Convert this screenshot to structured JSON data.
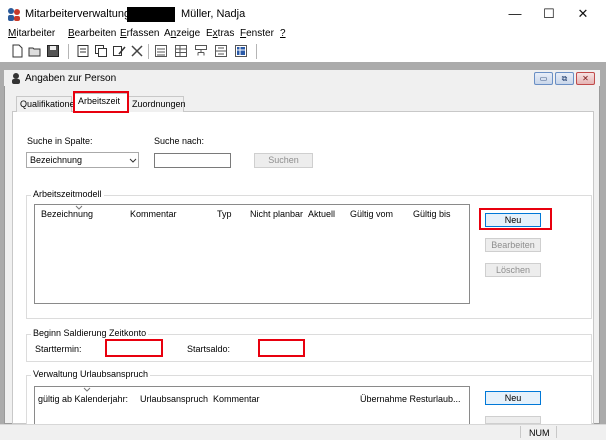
{
  "window": {
    "title_prefix": "Mitarbeiterverwaltung - ",
    "title_suffix": "Müller, Nadja",
    "minimize": "—",
    "maximize": "☐",
    "close": "✕"
  },
  "menu": [
    {
      "label": "Mitarbeiter",
      "accel": "M"
    },
    {
      "label": "Bearbeiten",
      "accel": "B"
    },
    {
      "label": "Erfassen",
      "accel": "E"
    },
    {
      "label": "Anzeige",
      "accel": "n"
    },
    {
      "label": "Extras",
      "accel": "x"
    },
    {
      "label": "Fenster",
      "accel": "F"
    },
    {
      "label": "?",
      "accel": "?"
    }
  ],
  "toolbar_icons": [
    "new-document-icon",
    "open-folder-icon",
    "save-icon",
    "properties-icon",
    "copy-icon",
    "delete-icon",
    "list-view-icon",
    "grid-view-icon",
    "tree-view-icon",
    "split-view-icon",
    "report-icon"
  ],
  "child_window": {
    "title": "Angaben zur Person",
    "minimize": "▭",
    "restore": "⧉",
    "close": "✕"
  },
  "tabs": [
    {
      "label": "Qualifikationen",
      "active": false
    },
    {
      "label": "Arbeitszeit",
      "active": true
    },
    {
      "label": "Zuordnungen",
      "active": false
    }
  ],
  "search": {
    "column_label": "Suche in Spalte:",
    "column_value": "Bezeichnung",
    "query_label": "Suche nach:",
    "query_value": "",
    "button": "Suchen"
  },
  "arbeitszeitmodell": {
    "title": "Arbeitszeitmodell",
    "columns": [
      "Bezeichnung",
      "Kommentar",
      "Typ",
      "Nicht planbar",
      "Aktuell",
      "Gültig vom",
      "Gültig bis"
    ],
    "rows": [],
    "buttons": {
      "new": "Neu",
      "edit": "Bearbeiten",
      "delete": "Löschen"
    }
  },
  "saldierung": {
    "title": "Beginn Saldierung Zeitkonto",
    "start_date_label": "Starttermin:",
    "start_date_value": "",
    "start_balance_label": "Startsaldo:",
    "start_balance_value": ""
  },
  "urlaub": {
    "title": "Verwaltung Urlaubsanspruch",
    "columns": [
      "gültig ab Kalenderjahr:",
      "Urlaubsanspruch",
      "Kommentar",
      "Übernahme Resturlaub..."
    ],
    "buttons": {
      "new": "Neu"
    }
  },
  "status": {
    "num": "NUM"
  },
  "colors": {
    "highlight": "#e8000e",
    "workspace": "#ababab",
    "focus": "#0078d7"
  }
}
